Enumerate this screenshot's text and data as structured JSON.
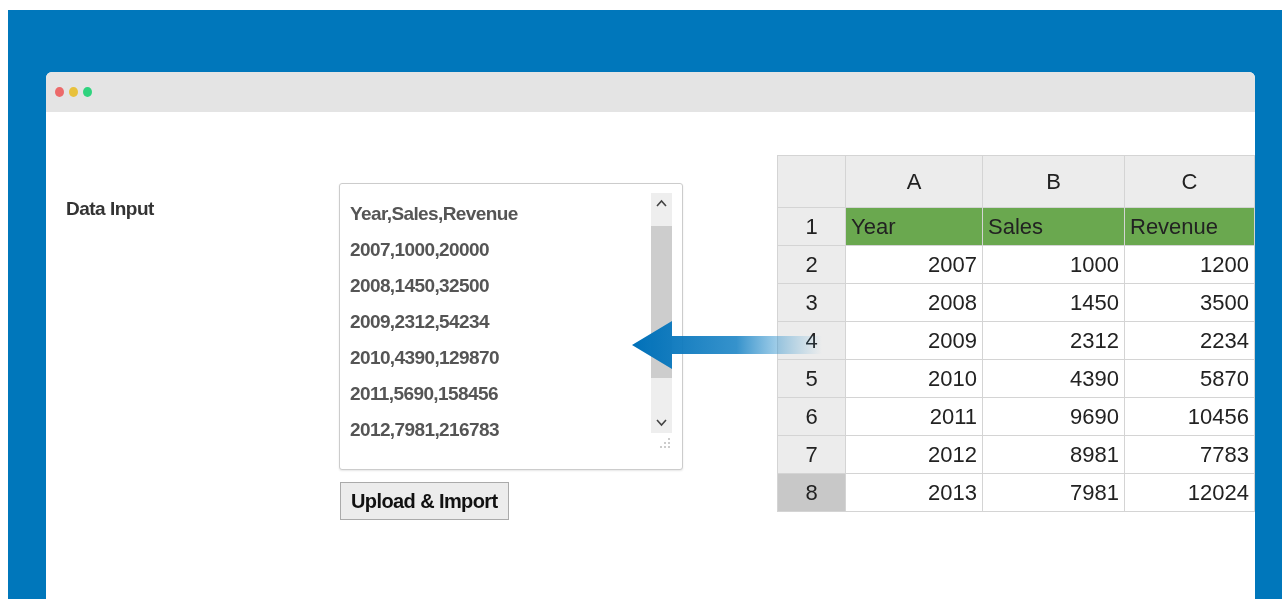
{
  "window": {
    "dots": [
      {
        "color": "#ec6a6a"
      },
      {
        "color": "#e8c13c"
      },
      {
        "color": "#2fd37e"
      }
    ]
  },
  "form": {
    "label": "Data Input",
    "textarea": {
      "lines": [
        "Year,Sales,Revenue",
        "2007,1000,20000",
        "2008,1450,32500",
        "2009,2312,54234",
        "2010,4390,129870",
        "2011,5690,158456",
        "2012,7981,216783"
      ]
    },
    "button": "Upload & Import"
  },
  "spreadsheet": {
    "columns": [
      "A",
      "B",
      "C"
    ],
    "rows": [
      {
        "number": "1",
        "selected": false,
        "header": true,
        "cells": [
          "Year",
          "Sales",
          "Revenue"
        ]
      },
      {
        "number": "2",
        "selected": false,
        "header": false,
        "cells": [
          "2007",
          "1000",
          "1200"
        ]
      },
      {
        "number": "3",
        "selected": false,
        "header": false,
        "cells": [
          "2008",
          "1450",
          "3500"
        ]
      },
      {
        "number": "4",
        "selected": false,
        "header": false,
        "cells": [
          "2009",
          "2312",
          "2234"
        ]
      },
      {
        "number": "5",
        "selected": false,
        "header": false,
        "cells": [
          "2010",
          "4390",
          "5870"
        ]
      },
      {
        "number": "6",
        "selected": false,
        "header": false,
        "cells": [
          "2011",
          "9690",
          "10456"
        ]
      },
      {
        "number": "7",
        "selected": false,
        "header": false,
        "cells": [
          "2012",
          "8981",
          "7783"
        ]
      },
      {
        "number": "8",
        "selected": true,
        "header": false,
        "cells": [
          "2013",
          "7981",
          "12024"
        ]
      }
    ]
  }
}
